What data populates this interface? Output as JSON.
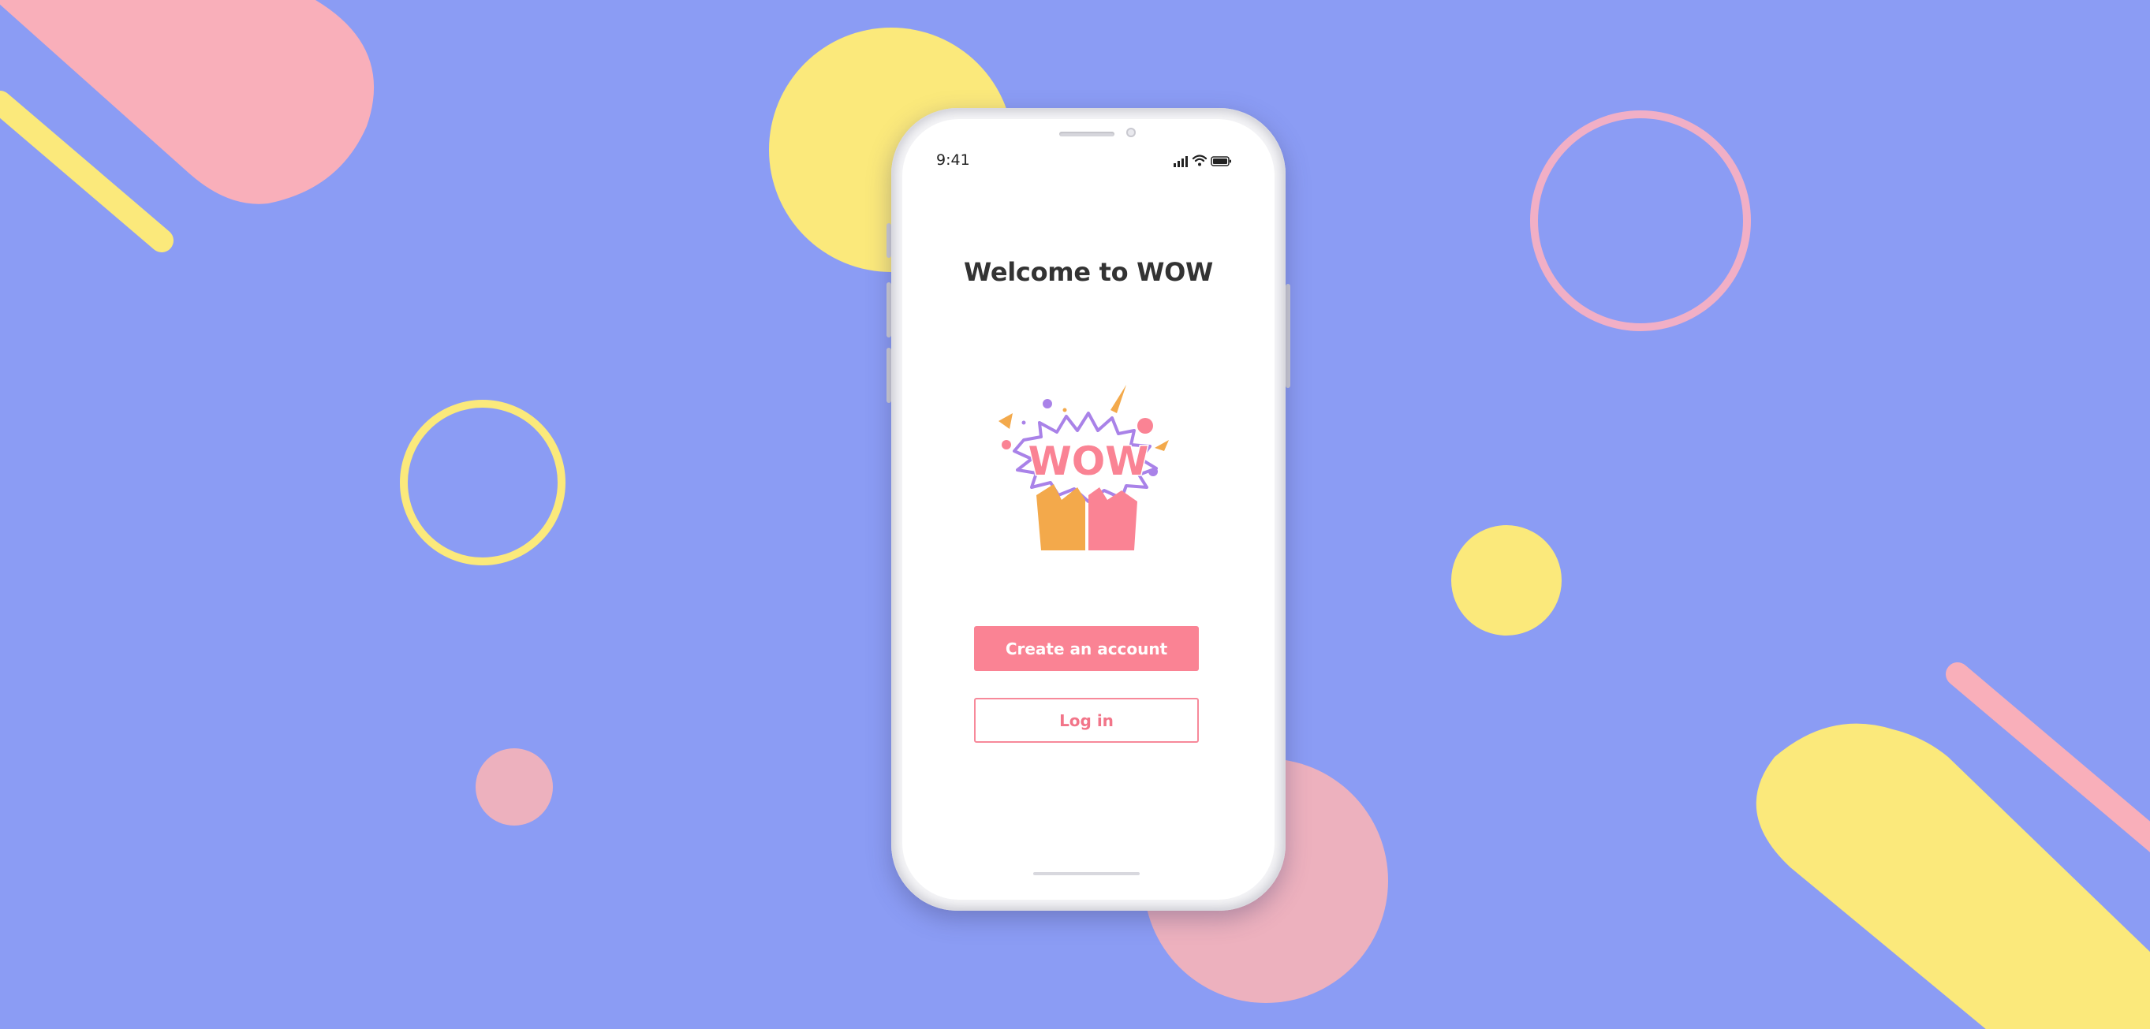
{
  "colors": {
    "background": "#8B9CF4",
    "pink": "#F9AFBA",
    "yellow": "#FBE97B",
    "primary_button": "#FA8394",
    "logo_orange": "#F3A94B",
    "logo_pink": "#FA8394",
    "logo_purple": "#A982E8"
  },
  "status_bar": {
    "time": "9:41",
    "icons": [
      "cellular-signal-icon",
      "wifi-icon",
      "battery-icon"
    ]
  },
  "screen": {
    "title": "Welcome to WOW",
    "logo_text": "WOW",
    "create_account_label": "Create an account",
    "login_label": "Log in"
  }
}
